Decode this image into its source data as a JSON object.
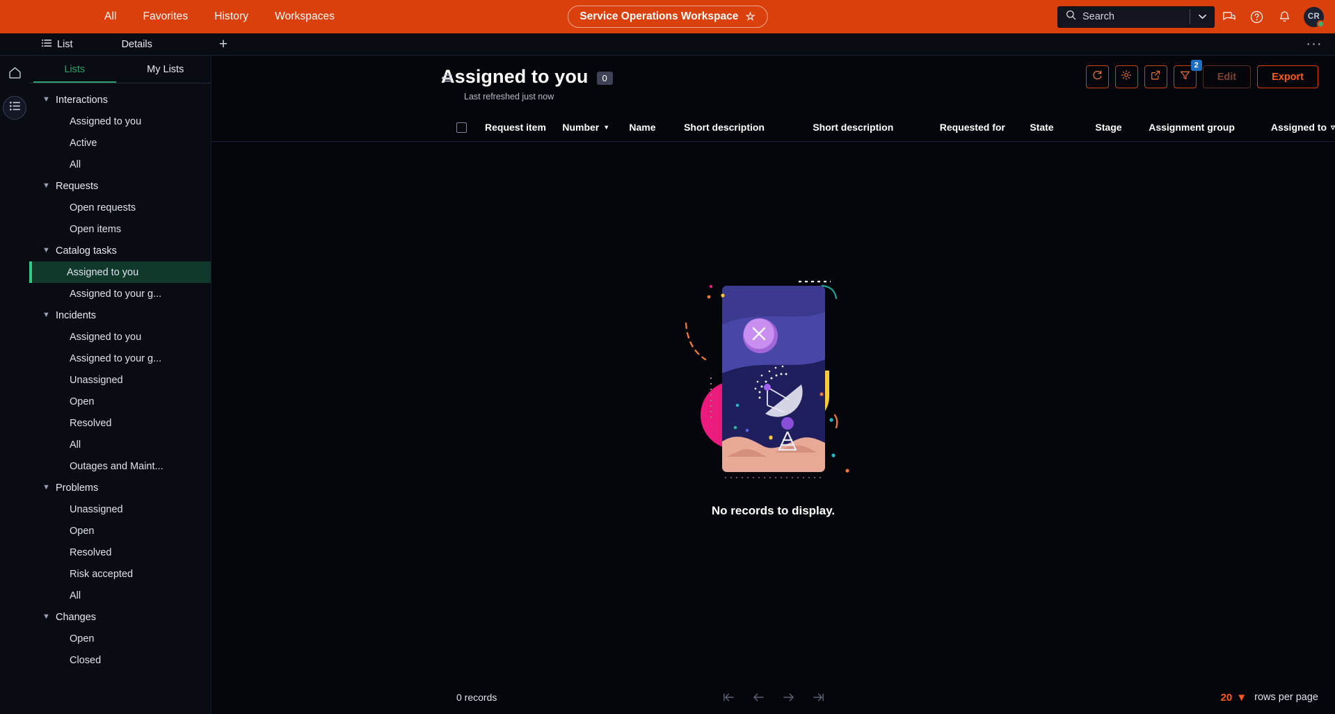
{
  "topbar": {
    "nav": [
      {
        "label": "All",
        "name": "topnav-all"
      },
      {
        "label": "Favorites",
        "name": "topnav-favorites"
      },
      {
        "label": "History",
        "name": "topnav-history"
      },
      {
        "label": "Workspaces",
        "name": "topnav-workspaces"
      }
    ],
    "workspace": "Service Operations Workspace",
    "star_glyph": "☆",
    "search": {
      "placeholder": "Search",
      "value": ""
    },
    "icons": [
      "search-icon",
      "chevron-down-icon",
      "conversations-icon",
      "help-icon",
      "notifications-icon"
    ],
    "avatar_initials": "CR",
    "brand_color": "#d9400b"
  },
  "tabstrip": {
    "tabs": [
      {
        "label": "List",
        "name": "tab-list"
      },
      {
        "label": "Details",
        "name": "tab-details"
      }
    ],
    "add_label": "+",
    "more_label": "···"
  },
  "sidebar": {
    "tabs": [
      {
        "label": "Lists",
        "active": true
      },
      {
        "label": "My Lists",
        "active": false
      }
    ],
    "accent_color": "#2ecc80",
    "groups": [
      {
        "label": "Interactions",
        "items": [
          {
            "label": "Assigned to you",
            "selected": false
          },
          {
            "label": "Active",
            "selected": false
          },
          {
            "label": "All",
            "selected": false
          }
        ]
      },
      {
        "label": "Requests",
        "items": [
          {
            "label": "Open requests",
            "selected": false
          },
          {
            "label": "Open items",
            "selected": false
          }
        ]
      },
      {
        "label": "Catalog tasks",
        "items": [
          {
            "label": "Assigned to you",
            "selected": true
          },
          {
            "label": "Assigned to your g...",
            "selected": false
          }
        ]
      },
      {
        "label": "Incidents",
        "items": [
          {
            "label": "Assigned to you",
            "selected": false
          },
          {
            "label": "Assigned to your g...",
            "selected": false
          },
          {
            "label": "Unassigned",
            "selected": false
          },
          {
            "label": "Open",
            "selected": false
          },
          {
            "label": "Resolved",
            "selected": false
          },
          {
            "label": "All",
            "selected": false
          },
          {
            "label": "Outages and Maint...",
            "selected": false
          }
        ]
      },
      {
        "label": "Problems",
        "items": [
          {
            "label": "Unassigned",
            "selected": false
          },
          {
            "label": "Open",
            "selected": false
          },
          {
            "label": "Resolved",
            "selected": false
          },
          {
            "label": "Risk accepted",
            "selected": false
          },
          {
            "label": "All",
            "selected": false
          }
        ]
      },
      {
        "label": "Changes",
        "items": [
          {
            "label": "Open",
            "selected": false
          },
          {
            "label": "Closed",
            "selected": false
          }
        ]
      }
    ]
  },
  "main": {
    "title": "Assigned to you",
    "count": "0",
    "refreshed": "Last refreshed just now",
    "actions": {
      "refresh": "refresh-icon",
      "settings": "gear-icon",
      "open_new": "open-in-new-icon",
      "filter": "filter-icon",
      "filter_badge": "2",
      "edit_label": "Edit",
      "export_label": "Export"
    },
    "columns": [
      {
        "label": "Request item",
        "sort": false,
        "filter": false
      },
      {
        "label": "Number",
        "sort": true,
        "filter": false
      },
      {
        "label": "Name",
        "sort": false,
        "filter": false
      },
      {
        "label": "Short description",
        "sort": false,
        "filter": false
      },
      {
        "label": "Short description",
        "sort": false,
        "filter": false
      },
      {
        "label": "Requested for",
        "sort": false,
        "filter": false
      },
      {
        "label": "State",
        "sort": false,
        "filter": false
      },
      {
        "label": "Stage",
        "sort": false,
        "filter": false
      },
      {
        "label": "Assignment group",
        "sort": false,
        "filter": false
      },
      {
        "label": "Assigned to",
        "sort": false,
        "filter": true
      }
    ],
    "empty_message": "No records to display.",
    "pager": {
      "records": "0 records",
      "first": "first-page-icon",
      "prev": "previous-page-icon",
      "next": "next-page-icon",
      "last": "last-page-icon",
      "rows_value": "20",
      "rows_label": "rows per page"
    }
  }
}
